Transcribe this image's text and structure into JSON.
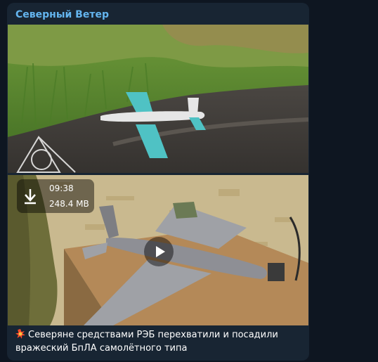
{
  "post": {
    "channel_name": "Северный Ветер",
    "caption_line1": "Северяне средствами РЭБ перехватили и посадили",
    "caption_line2": "вражеский БпЛА самолётного типа",
    "caption_icon": "collision-emoji-icon"
  },
  "video": {
    "duration": "09:38",
    "size": "248.4 MB",
    "download_icon": "download-arrow-icon",
    "play_icon": "play-icon"
  },
  "colors": {
    "chat_background": "#0e1621",
    "bubble_background": "#182533",
    "channel_name": "#64b5ef",
    "text": "#ffffff"
  }
}
